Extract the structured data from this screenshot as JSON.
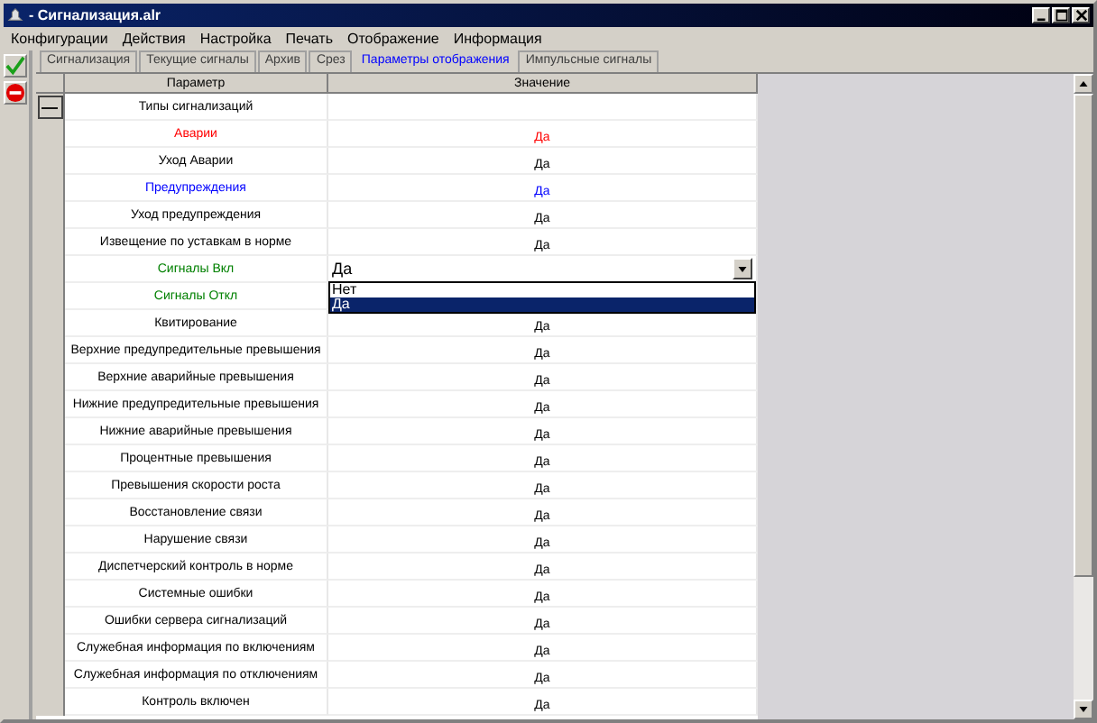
{
  "window": {
    "title": "- Сигнализация.alr"
  },
  "menu": [
    "Конфигурации",
    "Действия",
    "Настройка",
    "Печать",
    "Отображение",
    "Информация"
  ],
  "tabs": [
    {
      "label": "Сигнализация",
      "selected": false
    },
    {
      "label": "Текущие сигналы",
      "selected": false
    },
    {
      "label": "Архив",
      "selected": false
    },
    {
      "label": "Срез",
      "selected": false
    },
    {
      "label": "Параметры отображения",
      "selected": true
    },
    {
      "label": "Импульсные сигналы",
      "selected": false
    }
  ],
  "table": {
    "columns": [
      "Параметр",
      "Значение"
    ],
    "rows": [
      {
        "kind": "group",
        "expanded": true,
        "param": "Типы сигнализаций",
        "color": "#000000"
      },
      {
        "kind": "plain",
        "param": "Аварии",
        "value": "Да",
        "color": "#ff0000"
      },
      {
        "kind": "plain",
        "param": "Уход Аварии",
        "value": "Да",
        "color": "#000000"
      },
      {
        "kind": "plain",
        "param": "Предупреждения",
        "value": "Да",
        "color": "#0000ff"
      },
      {
        "kind": "plain",
        "param": "Уход предупреждения",
        "value": "Да",
        "color": "#000000"
      },
      {
        "kind": "plain",
        "param": "Извещение по уставкам в норме",
        "value": "Да",
        "color": "#000000"
      },
      {
        "kind": "dropdown",
        "param": "Сигналы Вкл",
        "value": "Да",
        "color": "#008000",
        "open": true,
        "options": [
          {
            "label": "Нет",
            "selected": false
          },
          {
            "label": "Да",
            "selected": true
          }
        ]
      },
      {
        "kind": "plain",
        "param": "Сигналы Откл",
        "color": "#008000"
      },
      {
        "kind": "plain",
        "param": "Квитирование",
        "value": "Да",
        "color": "#000000"
      },
      {
        "kind": "plain",
        "param": "Верхние предупредительные превышения",
        "value": "Да",
        "color": "#000000"
      },
      {
        "kind": "plain",
        "param": "Верхние аварийные превышения",
        "value": "Да",
        "color": "#000000"
      },
      {
        "kind": "plain",
        "param": "Нижние предупредительные превышения",
        "value": "Да",
        "color": "#000000"
      },
      {
        "kind": "plain",
        "param": "Нижние аварийные превышения",
        "value": "Да",
        "color": "#000000"
      },
      {
        "kind": "plain",
        "param": "Процентные превышения",
        "value": "Да",
        "color": "#000000"
      },
      {
        "kind": "plain",
        "param": "Превышения скорости роста",
        "value": "Да",
        "color": "#000000"
      },
      {
        "kind": "plain",
        "param": "Восстановление связи",
        "value": "Да",
        "color": "#000000"
      },
      {
        "kind": "plain",
        "param": "Нарушение связи",
        "value": "Да",
        "color": "#000000"
      },
      {
        "kind": "plain",
        "param": "Диспетчерский контроль в норме",
        "value": "Да",
        "color": "#000000"
      },
      {
        "kind": "plain",
        "param": "Системные ошибки",
        "value": "Да",
        "color": "#000000"
      },
      {
        "kind": "plain",
        "param": "Ошибки сервера сигнализаций",
        "value": "Да",
        "color": "#000000"
      },
      {
        "kind": "plain",
        "param": "Служебная информация по включениям",
        "value": "Да",
        "color": "#000000"
      },
      {
        "kind": "plain",
        "param": "Служебная информация по отключениям",
        "value": "Да",
        "color": "#000000"
      },
      {
        "kind": "plain",
        "param": "Контроль включен",
        "value": "Да",
        "color": "#000000"
      }
    ]
  }
}
